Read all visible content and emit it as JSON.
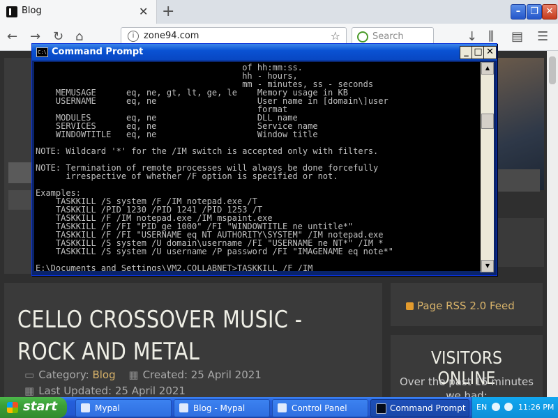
{
  "browser": {
    "tab_title": "Blog",
    "url": "zone94.com",
    "search_placeholder": "Search"
  },
  "cmd": {
    "title": "Command Prompt",
    "lines": [
      "                                         of hh:mm:ss.",
      "                                         hh - hours,",
      "                                         mm - minutes, ss - seconds",
      "    MEMUSAGE      eq, ne, gt, lt, ge, le    Memory usage in KB",
      "    USERNAME      eq, ne                    User name in [domain\\]user",
      "                                            format",
      "    MODULES       eq, ne                    DLL name",
      "    SERVICES      eq, ne                    Service name",
      "    WINDOWTITLE   eq, ne                    Window title",
      "",
      "NOTE: Wildcard '*' for the /IM switch is accepted only with filters.",
      "",
      "NOTE: Termination of remote processes will always be done forcefully",
      "      irrespective of whether /F option is specified or not.",
      "",
      "Examples:",
      "    TASKKILL /S system /F /IM notepad.exe /T",
      "    TASKKILL /PID 1230 /PID 1241 /PID 1253 /T",
      "    TASKKILL /F /IM notepad.exe /IM mspaint.exe",
      "    TASKKILL /F /FI \"PID ge 1000\" /FI \"WINDOWTITLE ne untitle*\"",
      "    TASKKILL /F /FI \"USERNAME eq NT AUTHORITY\\SYSTEM\" /IM notepad.exe",
      "    TASKKILL /S system /U domain\\username /FI \"USERNAME ne NT*\" /IM *",
      "    TASKKILL /S system /U username /P password /FI \"IMAGENAME eq note*\"",
      "",
      "E:\\Documents and Settings\\VM2.COLLABNET>TASKKILL /F /IM"
    ]
  },
  "page": {
    "article_title": "CELLO CROSSOVER MUSIC - ROCK AND METAL",
    "category_label": "Category: ",
    "category_value": "Blog",
    "created": "Created: 25 April 2021",
    "updated": "Last Updated: 25 April 2021",
    "rss": "Page RSS 2.0 Feed",
    "visitors_title": "VISITORS ONLINE",
    "visitors_sub": "Over the past 15 minutes",
    "visitors_sub2": "we had:"
  },
  "taskbar": {
    "start": "start",
    "tasks": [
      "Mypal",
      "Blog - Mypal",
      "Control Panel",
      "Command Prompt"
    ],
    "lang": "EN",
    "clock": "11:26 PM"
  }
}
